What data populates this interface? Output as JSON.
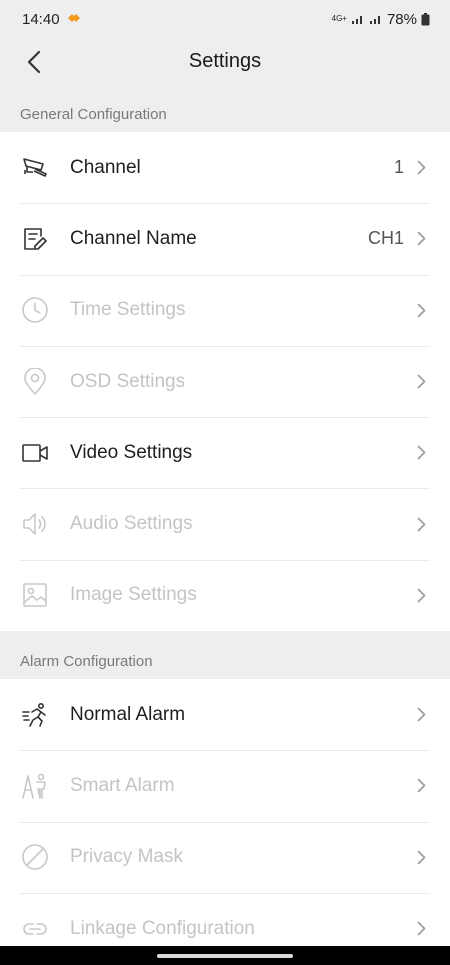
{
  "status": {
    "time": "14:40",
    "network": "4G+",
    "battery": "78%"
  },
  "header": {
    "title": "Settings"
  },
  "sections": {
    "general": {
      "title": "General Configuration",
      "items": [
        {
          "label": "Channel",
          "value": "1",
          "icon": "cctv-camera-icon",
          "enabled": true
        },
        {
          "label": "Channel Name",
          "value": "CH1",
          "icon": "edit-document-icon",
          "enabled": true
        },
        {
          "label": "Time Settings",
          "value": "",
          "icon": "clock-icon",
          "enabled": false
        },
        {
          "label": "OSD Settings",
          "value": "",
          "icon": "location-pin-icon",
          "enabled": false
        },
        {
          "label": "Video Settings",
          "value": "",
          "icon": "video-camera-icon",
          "enabled": true
        },
        {
          "label": "Audio Settings",
          "value": "",
          "icon": "speaker-icon",
          "enabled": false
        },
        {
          "label": "Image Settings",
          "value": "",
          "icon": "image-icon",
          "enabled": false
        }
      ]
    },
    "alarm": {
      "title": "Alarm Configuration",
      "items": [
        {
          "label": "Normal Alarm",
          "value": "",
          "icon": "running-person-icon",
          "enabled": true
        },
        {
          "label": "Smart Alarm",
          "value": "",
          "icon": "smart-person-icon",
          "enabled": false
        },
        {
          "label": "Privacy Mask",
          "value": "",
          "icon": "prohibited-icon",
          "enabled": false
        },
        {
          "label": "Linkage Configuration",
          "value": "",
          "icon": "link-icon",
          "enabled": false
        }
      ]
    }
  }
}
